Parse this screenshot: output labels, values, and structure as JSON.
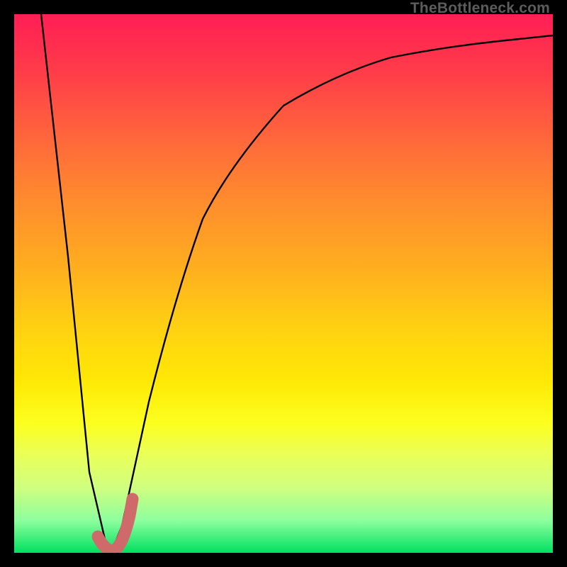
{
  "watermark": {
    "text": "TheBottleneck.com"
  },
  "colors": {
    "curve_black": "#000000",
    "highlight": "#cf6a6a",
    "gradient_top": "#ff1e55",
    "gradient_bottom": "#00e060"
  },
  "chart_data": {
    "type": "line",
    "title": "",
    "xlabel": "",
    "ylabel": "",
    "xlim": [
      0,
      100
    ],
    "ylim": [
      0,
      100
    ],
    "grid": false,
    "series": [
      {
        "name": "bottleneck-curve",
        "x": [
          5,
          10,
          14,
          17,
          18,
          20,
          25,
          30,
          35,
          40,
          50,
          60,
          70,
          80,
          90,
          100
        ],
        "y": [
          100,
          55,
          15,
          2,
          0,
          5,
          28,
          48,
          62,
          72,
          83,
          89,
          92,
          94,
          95,
          96
        ]
      }
    ],
    "highlight": {
      "name": "J-marker",
      "points": [
        {
          "x": 15.5,
          "y": 3
        },
        {
          "x": 16.5,
          "y": 1
        },
        {
          "x": 18,
          "y": 0
        },
        {
          "x": 20,
          "y": 2.5
        },
        {
          "x": 21.5,
          "y": 7
        },
        {
          "x": 22,
          "y": 10
        }
      ]
    }
  }
}
